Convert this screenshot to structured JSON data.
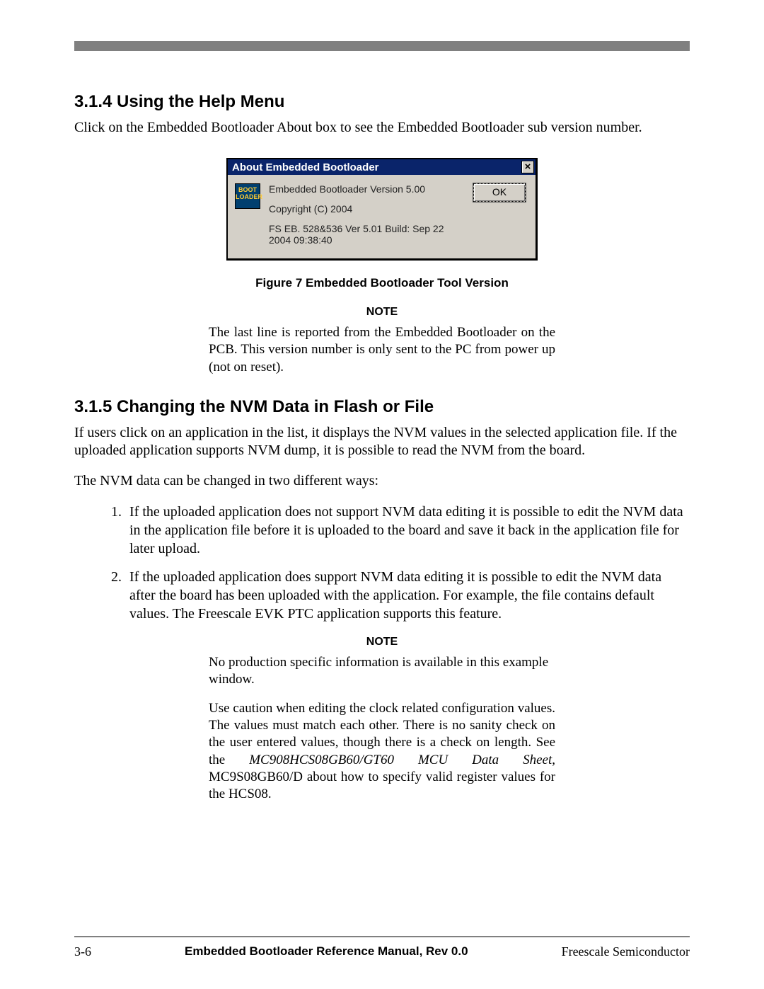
{
  "section314": {
    "heading": "3.1.4 Using the Help Menu",
    "para": "Click on the Embedded Bootloader About box to see the Embedded Bootloader sub version number."
  },
  "dialog": {
    "title": "About Embedded Bootloader",
    "close_glyph": "×",
    "icon_text": "BOOT\nLOADER",
    "line1": "Embedded Bootloader Version 5.00",
    "line2": "Copyright (C) 2004",
    "line3": "FS EB. 528&536 Ver 5.01 Build: Sep 22 2004 09:38:40",
    "ok_label": "OK"
  },
  "figure7_caption": "Figure 7 Embedded Bootloader Tool Version",
  "note1": {
    "label": "NOTE",
    "body": "The last line is reported from the Embedded Bootloader on the PCB. This version number is only sent to the PC from power up (not on reset)."
  },
  "section315": {
    "heading": "3.1.5 Changing the NVM Data in Flash or File",
    "para1": "If users click on an application in the list, it displays the NVM values in the selected application file. If the uploaded application supports NVM dump, it is possible to read the NVM from the board.",
    "para2": "The NVM data can be changed in two different ways:",
    "item1": "If the uploaded application does not support NVM data editing it is possible to edit the NVM data in the application file before it is uploaded to the board and save it back in the application file for later upload.",
    "item2": "If the uploaded application does support NVM data editing it is possible to edit the NVM data after the board has been uploaded with the application. For example, the file contains default values. The Freescale EVK PTC application supports this feature."
  },
  "note2": {
    "label": "NOTE",
    "body1": "No production specific information is available in this example window.",
    "body2_a": "Use caution when editing the clock related configuration values. The values must match each other. There is no sanity check on the user entered values, though there is a check on length. See the ",
    "body2_italic": "MC908HCS08GB60/GT60 MCU Data Sheet",
    "body2_b": ", MC9S08GB60/D about how to specify valid register values for the HCS08."
  },
  "footer": {
    "page": "3-6",
    "center": "Embedded Bootloader Reference Manual, Rev 0.0",
    "right": "Freescale Semiconductor"
  }
}
